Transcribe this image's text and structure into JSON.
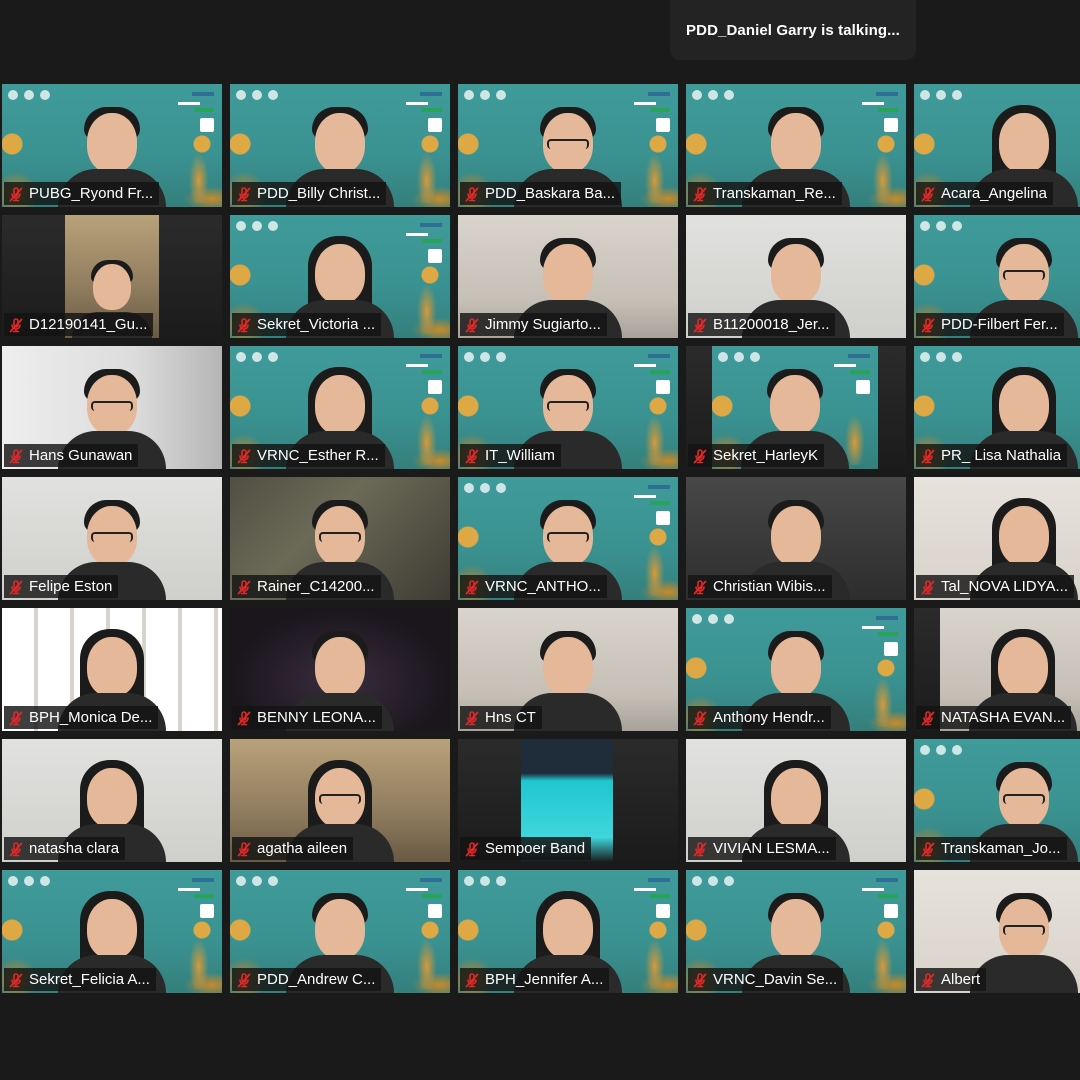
{
  "banner": {
    "talking": "PDD_Daniel Garry is talking..."
  },
  "participants": [
    {
      "name": "PUBG_Ryond Fr...",
      "bg": "ocean",
      "hair": "short",
      "muted": true
    },
    {
      "name": "PDD_Billy Christ...",
      "bg": "ocean",
      "hair": "short",
      "muted": true
    },
    {
      "name": "PDD_Baskara Ba...",
      "bg": "ocean",
      "hair": "short",
      "glasses": true,
      "muted": true
    },
    {
      "name": "Transkaman_Re...",
      "bg": "ocean",
      "hair": "short",
      "muted": true
    },
    {
      "name": "Acara_Angelina",
      "bg": "ocean",
      "hair": "long",
      "muted": true
    },
    {
      "name": "D12190141_Gu...",
      "bg": "room-warm",
      "inset": "narrow",
      "hair": "short",
      "muted": true
    },
    {
      "name": "Sekret_Victoria ...",
      "bg": "ocean",
      "hair": "long",
      "muted": true
    },
    {
      "name": "Jimmy Sugiarto...",
      "bg": "room-light",
      "hair": "short",
      "muted": true
    },
    {
      "name": "B11200018_Jer...",
      "bg": "room-gray",
      "hair": "short",
      "muted": true
    },
    {
      "name": "PDD-Filbert Fer...",
      "bg": "ocean",
      "hair": "short",
      "glasses": true,
      "muted": true
    },
    {
      "name": "Hans Gunawan",
      "bg": "curtain",
      "hair": "short",
      "glasses": true,
      "muted": true
    },
    {
      "name": "VRNC_Esther R...",
      "bg": "ocean",
      "hair": "long",
      "muted": true
    },
    {
      "name": "IT_William",
      "bg": "ocean",
      "hair": "short",
      "glasses": true,
      "muted": true
    },
    {
      "name": "Sekret_HarleyK",
      "bg": "ocean",
      "inset": "medium",
      "hair": "short",
      "muted": true
    },
    {
      "name": "PR_ Lisa Nathalia",
      "bg": "ocean",
      "hair": "long",
      "muted": true
    },
    {
      "name": "Felipe Eston",
      "bg": "room-gray",
      "hair": "short",
      "glasses": true,
      "muted": true
    },
    {
      "name": "Rainer_C14200...",
      "bg": "moss",
      "hair": "short",
      "glasses": true,
      "muted": true
    },
    {
      "name": "VRNC_ANTHO...",
      "bg": "ocean",
      "hair": "short",
      "glasses": true,
      "muted": true
    },
    {
      "name": "Christian Wibis...",
      "bg": "store",
      "hair": "short",
      "muted": true
    },
    {
      "name": "Tal_NOVA LIDYA...",
      "bg": "pale",
      "hair": "long",
      "muted": true
    },
    {
      "name": "BPH_Monica De...",
      "bg": "shelves",
      "hair": "long",
      "muted": true
    },
    {
      "name": "BENNY LEONA...",
      "bg": "dark-purple",
      "hair": "short",
      "muted": true
    },
    {
      "name": "Hns CT",
      "bg": "room-light",
      "hair": "short",
      "muted": true
    },
    {
      "name": "Anthony Hendr...",
      "bg": "ocean",
      "hair": "short",
      "muted": true
    },
    {
      "name": "NATASHA EVAN...",
      "bg": "room-light",
      "inset": "medium",
      "hair": "long",
      "muted": true
    },
    {
      "name": "natasha clara",
      "bg": "room-gray",
      "hair": "long",
      "muted": true
    },
    {
      "name": "agatha aileen",
      "bg": "room-warm",
      "hair": "long",
      "glasses": true,
      "muted": true
    },
    {
      "name": "Sempoer Band",
      "bg": "dark",
      "inset": "teal",
      "hair": "none",
      "muted": true
    },
    {
      "name": "VIVIAN LESMA...",
      "bg": "room-gray",
      "hair": "long",
      "muted": true
    },
    {
      "name": "Transkaman_Jo...",
      "bg": "ocean",
      "hair": "short",
      "glasses": true,
      "muted": true
    },
    {
      "name": "Sekret_Felicia A...",
      "bg": "ocean",
      "hair": "long",
      "muted": true
    },
    {
      "name": "PDD_Andrew C...",
      "bg": "ocean",
      "hair": "short",
      "muted": true
    },
    {
      "name": "BPH_Jennifer A...",
      "bg": "ocean",
      "hair": "long",
      "muted": true
    },
    {
      "name": "VRNC_Davin Se...",
      "bg": "ocean",
      "hair": "short",
      "muted": true
    },
    {
      "name": "Albert",
      "bg": "pale",
      "hair": "short",
      "glasses": true,
      "muted": true
    }
  ],
  "colors": {
    "background": "#1a1a1a",
    "mute_icon": "#e02828",
    "ocean": "#3f9b9a",
    "label_bg": "#141414"
  },
  "icons": {
    "mute": "microphone-muted-icon"
  }
}
